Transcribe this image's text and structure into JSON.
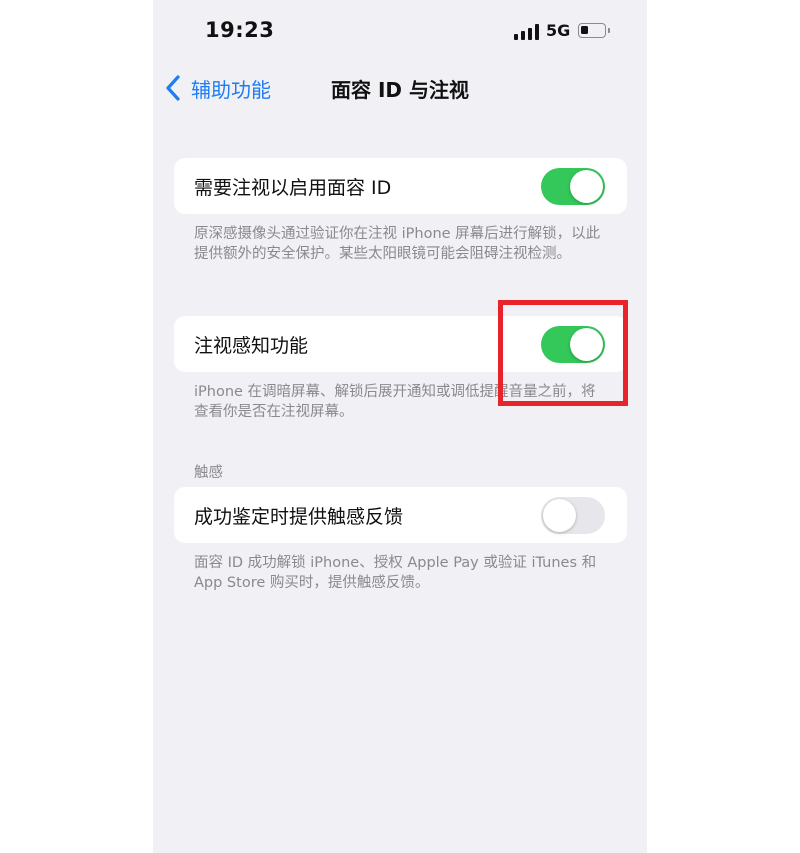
{
  "status_bar": {
    "time": "19:23",
    "network": "5G",
    "battery_level": 0.35
  },
  "nav": {
    "back_label": "辅助功能",
    "title": "面容 ID 与注视"
  },
  "attention_required": {
    "label": "需要注视以启用面容 ID",
    "enabled": true,
    "footnote": "原深感摄像头通过验证你在注视 iPhone 屏幕后进行解锁，以此提供额外的安全保护。某些太阳眼镜可能会阻碍注视检测。"
  },
  "attention_aware": {
    "label": "注视感知功能",
    "enabled": true,
    "footnote": "iPhone 在调暗屏幕、解锁后展开通知或调低提醒音量之前，将查看你是否在注视屏幕。"
  },
  "haptics_section": {
    "header": "触感",
    "label": "成功鉴定时提供触感反馈",
    "enabled": false,
    "footnote": "面容 ID 成功解锁 iPhone、授权 Apple Pay 或验证 iTunes 和 App Store 购买时，提供触感反馈。"
  },
  "colors": {
    "accent": "#1f7cf5",
    "toggle_on": "#34c759",
    "toggle_off": "#e6e6eb",
    "annotation": "#e8232b"
  },
  "icons": {
    "back": "chevron-left-icon",
    "signal": "cellular-signal-icon",
    "battery": "battery-icon"
  }
}
